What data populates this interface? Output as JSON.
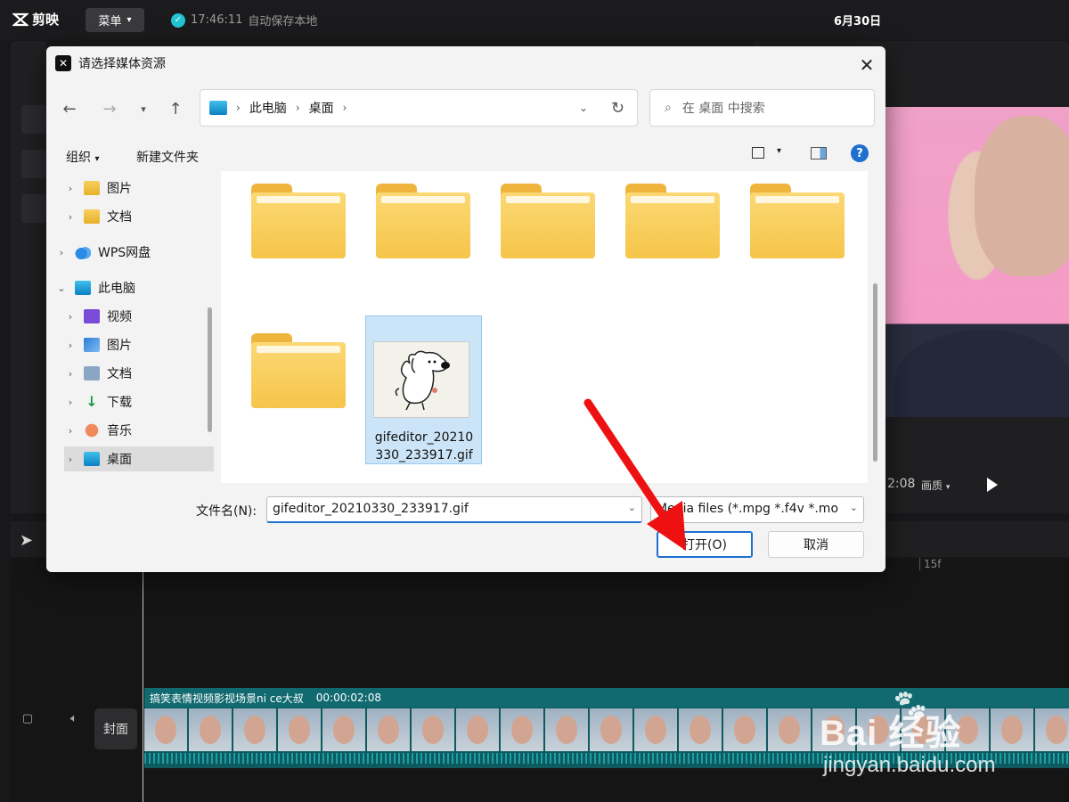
{
  "app": {
    "name": "剪映",
    "menu_label": "菜单",
    "save_time": "17:46:11",
    "save_text": "自动保存本地",
    "date": "6月30日",
    "preview_time": "2:08",
    "preview_quality": "画质"
  },
  "timeline": {
    "ruler_tick": "15f",
    "cover_label": "封面",
    "clip_title": "搞笑表情视频影视场景ni ce大叔",
    "clip_duration": "00:00:02:08"
  },
  "dialog": {
    "title": "请选择媒体资源",
    "breadcrumb": [
      "此电脑",
      "桌面"
    ],
    "search_placeholder": "在 桌面 中搜索",
    "commands": {
      "organize": "组织",
      "new_folder": "新建文件夹"
    },
    "nav_items": [
      {
        "label": "图片",
        "icon": "pictures-folder-icon",
        "indent": 1
      },
      {
        "label": "文档",
        "icon": "documents-folder-icon",
        "indent": 1
      },
      {
        "label": "WPS网盘",
        "icon": "wps-cloud-icon",
        "indent": 0
      },
      {
        "label": "此电脑",
        "icon": "this-pc-icon",
        "indent": 0,
        "expanded": true
      },
      {
        "label": "视频",
        "icon": "videos-icon",
        "indent": 1
      },
      {
        "label": "图片",
        "icon": "pictures-icon",
        "indent": 1
      },
      {
        "label": "文档",
        "icon": "documents-icon",
        "indent": 1
      },
      {
        "label": "下载",
        "icon": "downloads-icon",
        "indent": 1
      },
      {
        "label": "音乐",
        "icon": "music-icon",
        "indent": 1
      },
      {
        "label": "桌面",
        "icon": "desktop-icon",
        "indent": 1,
        "selected": true
      }
    ],
    "selected_file": {
      "name_line1": "gifeditor_20210",
      "name_line2": "330_233917.gif"
    },
    "filename_label": "文件名(N):",
    "filename_value": "gifeditor_20210330_233917.gif",
    "filetype_value": "Media files (*.mpg *.f4v *.mo",
    "open_label": "打开(O)",
    "cancel_label": "取消"
  },
  "watermark": {
    "brand": "Bai  经验",
    "url": "jingyan.baidu.com"
  },
  "colors": {
    "accent": "#1f6fd1",
    "annotation_arrow": "#ee1111",
    "clip_teal": "#0e5a5f"
  }
}
